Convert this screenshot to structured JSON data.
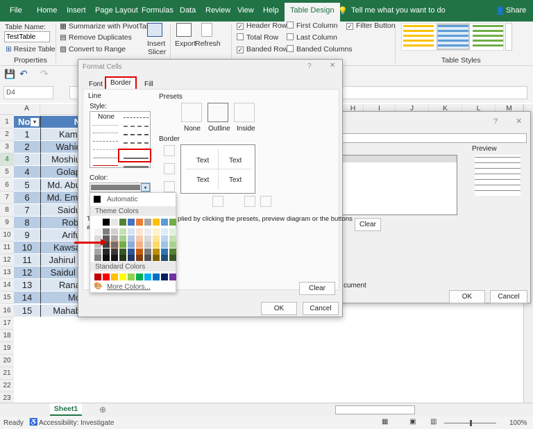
{
  "ribbon_tabs": [
    "File",
    "Home",
    "Insert",
    "Page Layout",
    "Formulas",
    "Data",
    "Review",
    "View",
    "Help",
    "Table Design"
  ],
  "tell_me": "Tell me what you want to do",
  "share": "Share",
  "properties": {
    "table_name_label": "Table Name:",
    "table_name_value": "TestTable",
    "resize": "Resize Table",
    "group": "Properties"
  },
  "tools": {
    "summarize": "Summarize with PivotTable",
    "remove_dup": "Remove Duplicates",
    "convert": "Convert to Range",
    "insert_slicer_1": "Insert",
    "insert_slicer_2": "Slicer",
    "export": "Export",
    "refresh": "Refresh"
  },
  "style_options": {
    "header_row": "Header Row",
    "total_row": "Total Row",
    "banded_rows": "Banded Rows",
    "first_column": "First Column",
    "last_column": "Last Column",
    "banded_columns": "Banded Columns",
    "filter_button": "Filter Button",
    "checked": {
      "header_row": true,
      "total_row": false,
      "banded_rows": true,
      "first_column": false,
      "last_column": false,
      "banded_columns": false,
      "filter_button": true
    }
  },
  "table_styles_label": "Table Styles",
  "name_box": "D4",
  "columns": [
    "A",
    "",
    "H",
    "I",
    "J",
    "K",
    "L",
    "M"
  ],
  "rows": [
    "1",
    "2",
    "3",
    "4",
    "5",
    "6",
    "7",
    "8",
    "9",
    "10",
    "11",
    "12",
    "13",
    "14",
    "15",
    "16",
    "17",
    "18",
    "19",
    "20",
    "21",
    "22",
    "23"
  ],
  "table": {
    "header": [
      "No",
      "N"
    ],
    "no": [
      "1",
      "2",
      "3",
      "4",
      "5",
      "6",
      "7",
      "8",
      "9",
      "10",
      "11",
      "12",
      "13",
      "14",
      "15"
    ],
    "names": [
      "Kamr",
      "Wahic",
      "Moshiu",
      "Golap",
      "Md. Abu",
      "Md. Emt",
      "Saidu",
      "Robi",
      "Arifu",
      "Kawsa",
      "Jahirul I",
      "Saidul I",
      "Rana",
      "Mo",
      "Mahab"
    ]
  },
  "sheet_tab": "Sheet1",
  "status": {
    "ready": "Ready",
    "accessibility": "Accessibility: Investigate",
    "zoom": "100%"
  },
  "bg_dialog": {
    "help": "?",
    "close": "✕",
    "preview": "Preview",
    "clear": "Clear",
    "text_fragment": "cument",
    "ok": "OK",
    "cancel": "Cancel"
  },
  "format_cells": {
    "title": "Format Cells",
    "help": "?",
    "close": "✕",
    "tabs": [
      "Font",
      "Border",
      "Fill"
    ],
    "line": "Line",
    "style": "Style:",
    "none": "None",
    "color": "Color:",
    "presets": "Presets",
    "preset_labels": [
      "None",
      "Outline",
      "Inside"
    ],
    "border": "Border",
    "preview_text": [
      "Text",
      "Text",
      "Text",
      "Text"
    ],
    "hint": "The selected border style can be applied by clicking the presets, preview diagram or the buttons above.",
    "hint_visible": "plied by clicking the presets, preview diagram or the buttons",
    "hint_left": [
      "Th",
      "ab"
    ],
    "clear": "Clear",
    "ok": "OK",
    "cancel": "Cancel",
    "selected_color": "#7f7f7f"
  },
  "color_menu": {
    "automatic": "Automatic",
    "theme_colors": "Theme Colors",
    "standard_colors": "Standard Colors",
    "more_colors": "More Colors...",
    "theme": [
      "#ffffff",
      "#000000",
      "#e7e6e6",
      "#548235",
      "#4472c4",
      "#ed7d31",
      "#a5a5a5",
      "#ffc000",
      "#5b9bd5",
      "#70ad47"
    ],
    "shades": [
      [
        "#f2f2f2",
        "#d9d9d9",
        "#bfbfbf",
        "#a6a6a6",
        "#808080"
      ],
      [
        "#7f7f7f",
        "#595959",
        "#404040",
        "#262626",
        "#0d0d0d"
      ],
      [
        "#d0cece",
        "#aeaaaa",
        "#767171",
        "#3a3838",
        "#171616"
      ],
      [
        "#c5e0b3",
        "#a8d08d",
        "#70ad47",
        "#385723",
        "#253a17"
      ],
      [
        "#d9e2f3",
        "#b4c6e7",
        "#8eaadb",
        "#2f5496",
        "#1f3864"
      ],
      [
        "#fbe4d5",
        "#f7caac",
        "#f4b083",
        "#c55a11",
        "#833c0b"
      ],
      [
        "#ededed",
        "#dbdbdb",
        "#c9c9c9",
        "#7b7b7b",
        "#525252"
      ],
      [
        "#fff2cc",
        "#fee599",
        "#ffd965",
        "#bf8f00",
        "#7f6000"
      ],
      [
        "#deeaf6",
        "#bdd6ee",
        "#9cc2e5",
        "#2e74b5",
        "#1f4e79"
      ],
      [
        "#e2efd9",
        "#c5e0b3",
        "#a8d08d",
        "#538135",
        "#375623"
      ]
    ],
    "standard": [
      "#c00000",
      "#ff0000",
      "#ffc000",
      "#ffff00",
      "#92d050",
      "#00b050",
      "#00b0f0",
      "#0070c0",
      "#002060",
      "#7030a0"
    ]
  },
  "accent_color": "#217346",
  "highlight_color": "#e00000"
}
